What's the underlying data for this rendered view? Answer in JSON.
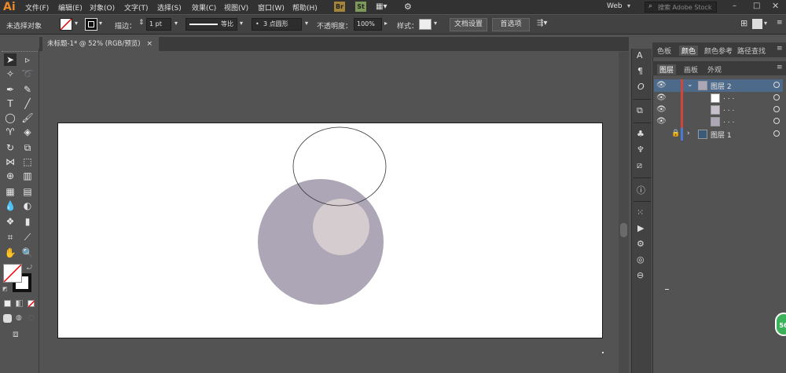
{
  "app": {
    "logo": "Ai"
  },
  "menu": [
    "文件(F)",
    "编辑(E)",
    "对象(O)",
    "文字(T)",
    "选择(S)",
    "效果(C)",
    "视图(V)",
    "窗口(W)",
    "帮助(H)"
  ],
  "menubar_right": {
    "br": "Br",
    "st": "St",
    "workspace": "Web",
    "search_placeholder": "搜索 Adobe Stock"
  },
  "control": {
    "no_selection": "未选择对象",
    "stroke_label": "描边：",
    "stroke_value": "1 pt",
    "line_style": "等比",
    "brush": "3 点圆形",
    "opacity_label": "不透明度：",
    "opacity_value": "100%",
    "style_label": "样式：",
    "doc_setup": "文档设置",
    "preferences": "首选项"
  },
  "document": {
    "tab_title": "未标题-1* @ 52% (RGB/预览)",
    "close": "×"
  },
  "panel": {
    "top_tabs": [
      "色板",
      "颜色",
      "颜色参考",
      "路径查找"
    ],
    "layer_tabs": [
      "图层",
      "画板",
      "外观"
    ],
    "layers": [
      {
        "name": "图层 2",
        "expanded": true
      },
      {
        "name": ". . .",
        "sub": true
      },
      {
        "name": ". . .",
        "sub": true
      },
      {
        "name": ". . .",
        "sub": true
      },
      {
        "name": "图层 1",
        "expanded": false
      }
    ]
  },
  "colors": {
    "big_circle": "#aca6b6",
    "small_circle": "#d5cccf",
    "layer_bar": "#d0453c",
    "selection_row": "#4d6a8a"
  },
  "badge": {
    "text": "56"
  }
}
